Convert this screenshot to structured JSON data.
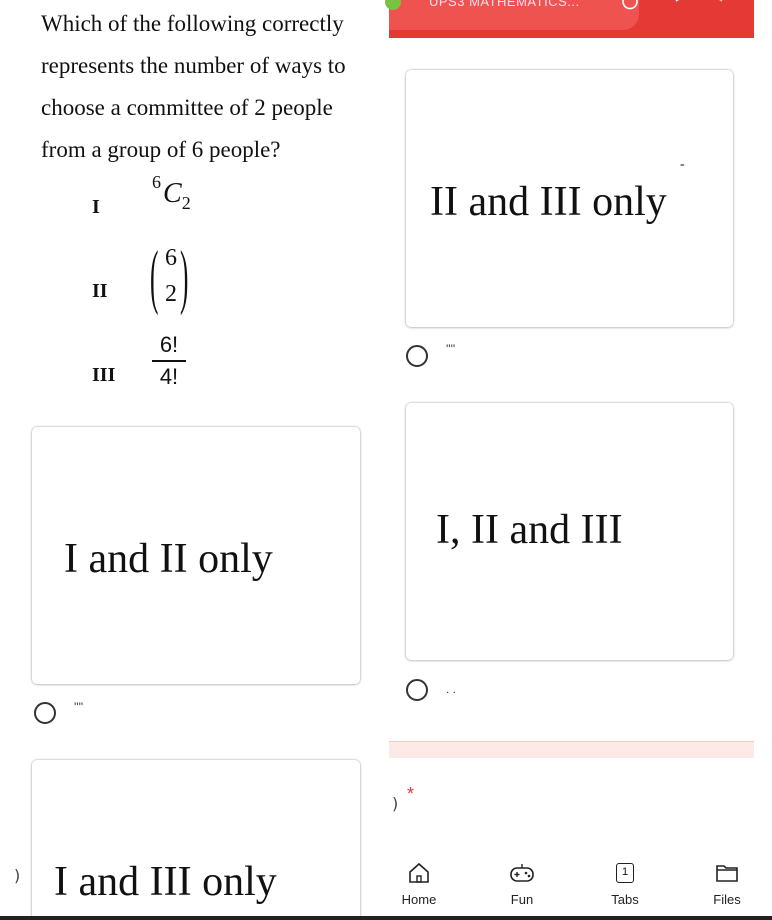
{
  "question": {
    "lines": [
      "Which of the following correctly",
      "represents the number of ways to",
      "choose a committee of 2 people",
      "from a group of 6 people?"
    ],
    "statements": [
      {
        "roman": "I",
        "expr_sup": "6",
        "expr_main": "C",
        "expr_sub": "2"
      },
      {
        "roman": "II",
        "top": "6",
        "bottom": "2"
      },
      {
        "roman": "III",
        "numerator": "6!",
        "denominator": "4!"
      }
    ]
  },
  "topbar": {
    "title": "UPS3 MATHEMATICS...",
    "colors": {
      "bar": "#e53935",
      "pill": "#ef5350",
      "dot": "#7cc242"
    }
  },
  "options": [
    {
      "text": "II and III only",
      "radio_label": "''''"
    },
    {
      "text": "I and II only",
      "radio_label": "''''"
    },
    {
      "text": "I, II and  III",
      "radio_label": ". ."
    },
    {
      "text": "I and III only",
      "radio_label": ")"
    }
  ],
  "asterisk": "*",
  "bottom_nav": {
    "items": [
      {
        "label": "Home",
        "icon": "home-icon"
      },
      {
        "label": "Fun",
        "icon": "gamepad-icon"
      },
      {
        "label": "Tabs",
        "icon": "tabs-icon",
        "badge": "1"
      },
      {
        "label": "Files",
        "icon": "folder-icon"
      }
    ]
  }
}
